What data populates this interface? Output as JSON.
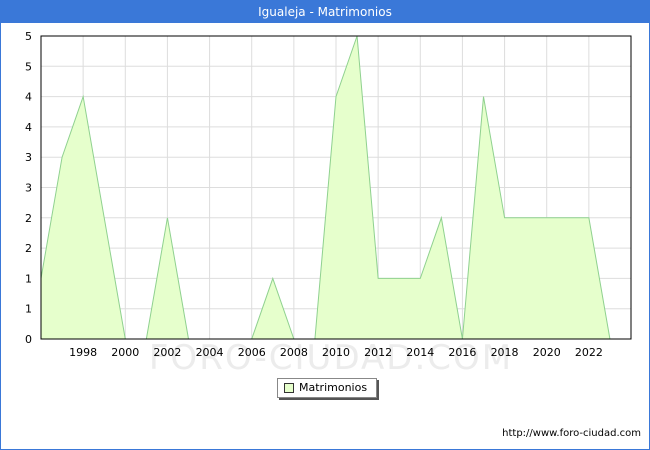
{
  "title": "Igualeja - Matrimonios",
  "source_text": "http://www.foro-ciudad.com",
  "watermark": "FORO-CIUDAD.COM",
  "colors": {
    "title_bg": "#3a78d8",
    "area_fill": "#e6ffcc",
    "area_line": "#8fd18f",
    "grid": "#dddddd"
  },
  "chart_data": {
    "type": "area",
    "title": "Igualeja - Matrimonios",
    "xlabel": "",
    "ylabel": "",
    "x": [
      1996,
      1997,
      1998,
      1999,
      2000,
      2001,
      2002,
      2003,
      2004,
      2005,
      2006,
      2007,
      2008,
      2009,
      2010,
      2011,
      2012,
      2013,
      2014,
      2015,
      2016,
      2017,
      2018,
      2019,
      2020,
      2021,
      2022,
      2023
    ],
    "series": [
      {
        "name": "Matrimonios",
        "values": [
          1,
          3,
          4,
          2,
          0,
          0,
          2,
          0,
          0,
          0,
          0,
          1,
          0,
          0,
          4,
          5,
          1,
          1,
          1,
          2,
          0,
          4,
          2,
          2,
          2,
          2,
          2,
          0
        ]
      }
    ],
    "xlim": [
      1996,
      2024
    ],
    "ylim": [
      0,
      5
    ],
    "x_ticks": [
      1998,
      2000,
      2002,
      2004,
      2006,
      2008,
      2010,
      2012,
      2014,
      2016,
      2018,
      2020,
      2022
    ],
    "y_tick_labels": [
      "0",
      "1",
      "1",
      "2",
      "2",
      "3",
      "3",
      "4",
      "4",
      "5",
      "5"
    ],
    "grid": true,
    "legend": "bottom-center"
  }
}
